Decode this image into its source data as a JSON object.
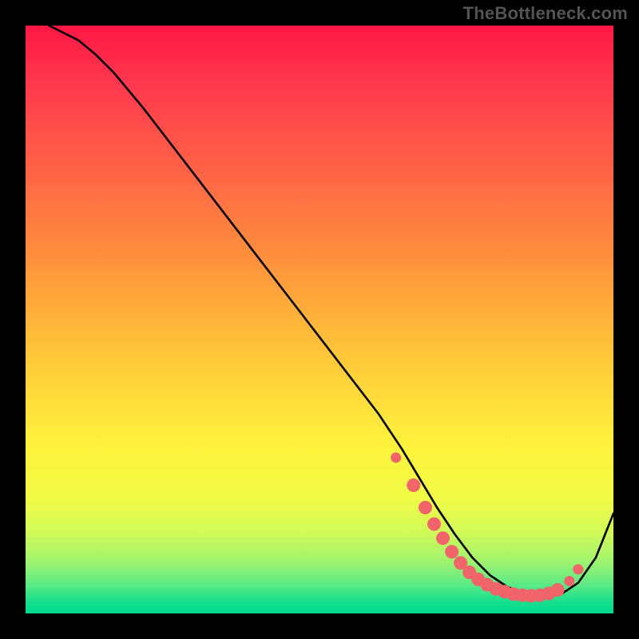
{
  "watermark": "TheBottleneck.com",
  "chart_data": {
    "type": "line",
    "title": "",
    "xlabel": "",
    "ylabel": "",
    "xlim": [
      0,
      100
    ],
    "ylim": [
      0,
      100
    ],
    "series": [
      {
        "name": "curve",
        "x": [
          4,
          6,
          9,
          12,
          15,
          20,
          25,
          30,
          35,
          40,
          45,
          50,
          55,
          60,
          64,
          67,
          70,
          73,
          76,
          79,
          82,
          85,
          88,
          91,
          94,
          97,
          100
        ],
        "y": [
          100,
          99,
          97.5,
          95,
          92,
          86,
          79.5,
          73,
          66.5,
          60,
          53.5,
          47,
          40.5,
          34,
          28,
          23,
          18,
          13.5,
          9.5,
          6.5,
          4.5,
          3.3,
          2.8,
          3.2,
          5.2,
          9.5,
          17
        ]
      }
    ],
    "markers": {
      "name": "highlight-dots",
      "color": "#f16469",
      "points": [
        {
          "x": 63,
          "y": 26.5
        },
        {
          "x": 66,
          "y": 21.8
        },
        {
          "x": 68,
          "y": 18.0
        },
        {
          "x": 69.5,
          "y": 15.2
        },
        {
          "x": 71,
          "y": 12.8
        },
        {
          "x": 72.5,
          "y": 10.5
        },
        {
          "x": 74,
          "y": 8.6
        },
        {
          "x": 75.5,
          "y": 7.0
        },
        {
          "x": 77,
          "y": 5.8
        },
        {
          "x": 78.5,
          "y": 4.9
        },
        {
          "x": 80,
          "y": 4.2
        },
        {
          "x": 81.5,
          "y": 3.7
        },
        {
          "x": 83,
          "y": 3.3
        },
        {
          "x": 84.5,
          "y": 3.1
        },
        {
          "x": 86,
          "y": 3.0
        },
        {
          "x": 87.5,
          "y": 3.1
        },
        {
          "x": 89,
          "y": 3.4
        },
        {
          "x": 90.5,
          "y": 4.0
        },
        {
          "x": 92.5,
          "y": 5.5
        },
        {
          "x": 94,
          "y": 7.5
        }
      ]
    },
    "gradient_stops": [
      {
        "pos": 0.0,
        "color": "#ff1745"
      },
      {
        "pos": 0.5,
        "color": "#ffb339"
      },
      {
        "pos": 0.75,
        "color": "#fdf33d"
      },
      {
        "pos": 0.95,
        "color": "#5eea85"
      },
      {
        "pos": 1.0,
        "color": "#00d98f"
      }
    ]
  }
}
